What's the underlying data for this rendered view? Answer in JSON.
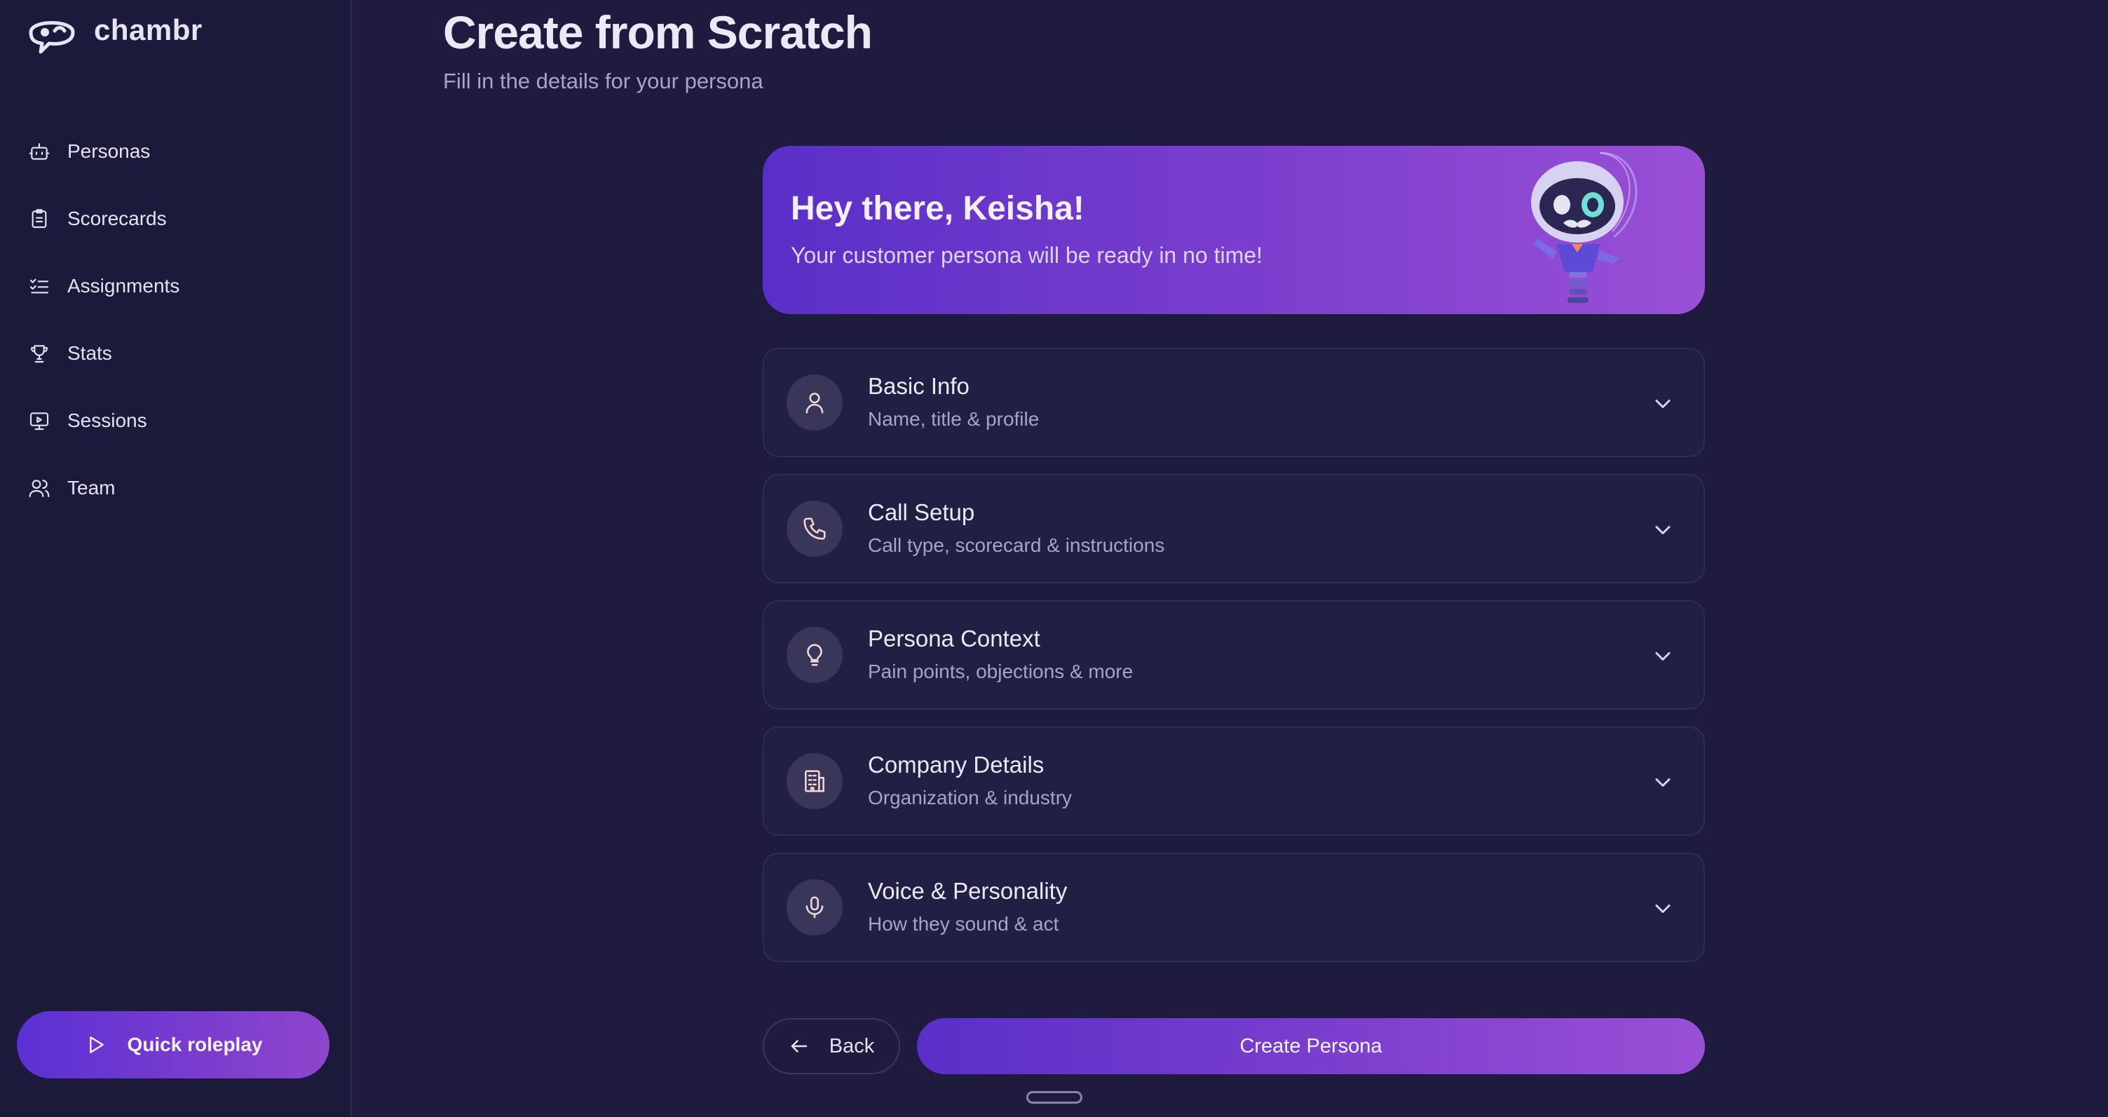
{
  "app": {
    "name": "chambr"
  },
  "sidebar": {
    "items": [
      {
        "label": "Personas",
        "icon": "bot-icon"
      },
      {
        "label": "Scorecards",
        "icon": "clipboard-icon"
      },
      {
        "label": "Assignments",
        "icon": "checklist-icon"
      },
      {
        "label": "Stats",
        "icon": "trophy-icon"
      },
      {
        "label": "Sessions",
        "icon": "monitor-play-icon"
      },
      {
        "label": "Team",
        "icon": "users-icon"
      }
    ],
    "quick_roleplay_label": "Quick roleplay"
  },
  "page": {
    "title": "Create from Scratch",
    "subtitle": "Fill in the details for your persona"
  },
  "banner": {
    "title": "Hey there, Keisha!",
    "subtitle": "Your customer persona will be ready in no time!"
  },
  "sections": [
    {
      "title": "Basic Info",
      "subtitle": "Name, title & profile",
      "icon": "user-icon"
    },
    {
      "title": "Call Setup",
      "subtitle": "Call type, scorecard & instructions",
      "icon": "phone-icon"
    },
    {
      "title": "Persona Context",
      "subtitle": "Pain points, objections & more",
      "icon": "lightbulb-icon"
    },
    {
      "title": "Company Details",
      "subtitle": "Organization & industry",
      "icon": "building-icon"
    },
    {
      "title": "Voice & Personality",
      "subtitle": "How they sound & act",
      "icon": "microphone-icon"
    }
  ],
  "actions": {
    "back_label": "Back",
    "create_label": "Create Persona"
  },
  "colors": {
    "background": "#1e1b3f",
    "sidebar": "#1c1a3b",
    "accent_start": "#5a2fc8",
    "accent_end": "#9a4fd6",
    "icon_tint": "#f3d9d6"
  }
}
